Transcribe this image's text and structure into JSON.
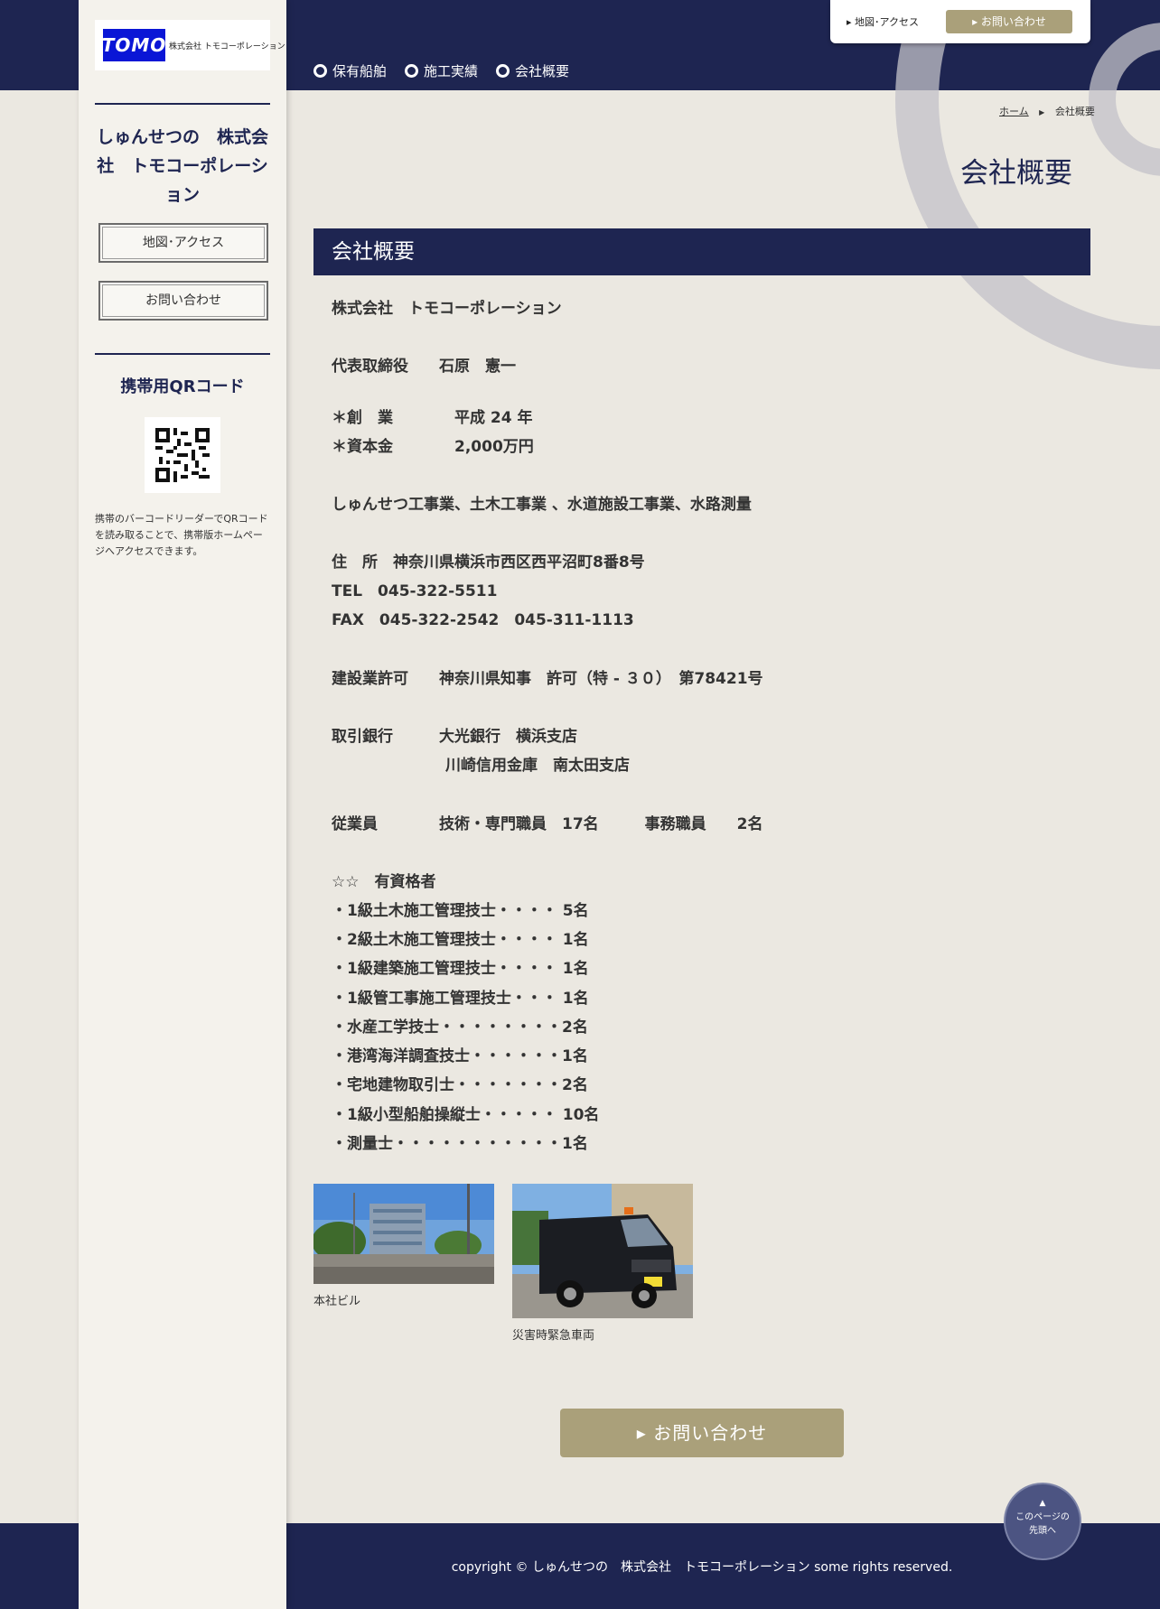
{
  "header": {
    "nav": [
      "保有船舶",
      "施工実績",
      "会社概要"
    ],
    "util_map": "地図･アクセス",
    "util_contact": "お問い合わせ"
  },
  "sidebar": {
    "logo_mark": "TOMO",
    "logo_text": "株式会社 トモコーポレーション",
    "company": "しゅんせつの　株式会社　トモコーポレーション",
    "btn_map": "地図･アクセス",
    "btn_contact": "お問い合わせ",
    "qr_title": "携帯用QRコード",
    "qr_note": "携帯のバーコードリーダーでQRコードを読み取ることで、携帯版ホームページへアクセスできます。"
  },
  "breadcrumb": {
    "home": "ホーム",
    "current": "会社概要"
  },
  "page_title": "会社概要",
  "section_title": "会社概要",
  "content": {
    "company_name": "株式会社　トモコーポレーション",
    "representative": "代表取締役　　石原　憲一",
    "founded": "＊創　業　　　　平成 24 年",
    "capital": "＊資本金　　　　2,000万円",
    "business": "しゅんせつ工事業、土木工事業 、水道施設工事業、水路測量",
    "address": "住　所　神奈川県横浜市西区西平沼町8番8号",
    "tel": "TEL　045-322-5511",
    "fax": "FAX　045-322-2542　045-311-1113",
    "license": "建設業許可　　神奈川県知事　許可（特 - ３０）　第78421号",
    "bank_1": "取引銀行　　　大光銀行　横浜支店",
    "bank_2": "川崎信用金庫　南太田支店",
    "employees": "従業員　　　　技術・専門職員　17名　　　事務職員　　2名",
    "qualified_header": "☆☆　有資格者",
    "qualifications": [
      "・1級土木施工管理技士・・・・ 5名",
      "・2級土木施工管理技士・・・・ 1名",
      "・1級建築施工管理技士・・・・ 1名",
      "・1級管工事施工管理技士・・・ 1名",
      "・水産工学技士・・・・・・・・2名",
      "・港湾海洋調査技士・・・・・・1名",
      "・宅地建物取引士・・・・・・・2名",
      "・1級小型船舶操縦士・・・・・ 10名",
      "・測量士・・・・・・・・・・・1名"
    ]
  },
  "photos": [
    {
      "caption": "本社ビル"
    },
    {
      "caption": "災害時緊急車両"
    }
  ],
  "contact_button": "お問い合わせ",
  "to_top": {
    "line1": "このページの",
    "line2": "先頭へ"
  },
  "footer": {
    "copyright": "copyright © しゅんせつの　株式会社　トモコーポレーション some rights reserved."
  }
}
